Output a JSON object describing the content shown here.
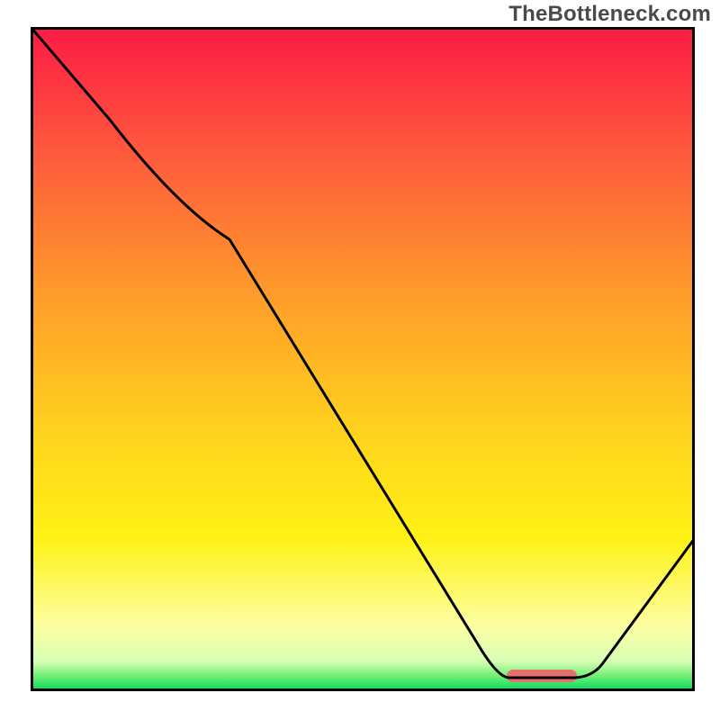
{
  "watermark": "TheBottleneck.com",
  "chart_data": {
    "type": "line",
    "title": "",
    "xlabel": "",
    "ylabel": "",
    "xlim": [
      0,
      1
    ],
    "ylim": [
      0,
      1
    ],
    "grid": false,
    "legend": false,
    "background": {
      "kind": "vertical-gradient",
      "description": "red at top through orange and yellow to pale-yellow, thin green band at bottom",
      "stops": [
        {
          "pos": 0.0,
          "color": "#fc1a45"
        },
        {
          "pos": 0.2,
          "color": "#fe5d3c"
        },
        {
          "pos": 0.4,
          "color": "#ff9b2b"
        },
        {
          "pos": 0.6,
          "color": "#ffd01e"
        },
        {
          "pos": 0.77,
          "color": "#fff215"
        },
        {
          "pos": 0.9,
          "color": "#fdffa0"
        },
        {
          "pos": 0.955,
          "color": "#d6ffb5"
        },
        {
          "pos": 0.975,
          "color": "#7af07a"
        },
        {
          "pos": 1.0,
          "color": "#00db5a"
        }
      ]
    },
    "sweet_spot_marker": {
      "x_range": [
        0.72,
        0.82
      ],
      "y": 0.02,
      "color": "#e76f6f",
      "note": "short rounded bar marking the optimum near x≈0.77"
    },
    "series": [
      {
        "name": "curve",
        "color": "#000000",
        "x": [
          0.0,
          0.12,
          0.22,
          0.3,
          0.68,
          0.72,
          0.82,
          0.86,
          1.0
        ],
        "y": [
          1.0,
          0.86,
          0.73,
          0.68,
          0.06,
          0.02,
          0.02,
          0.04,
          0.23
        ],
        "shape_notes": "Starts at top-left, gentle bend around x≈0.22–0.30, long straight descent to x≈0.68, flat minimum 0.72–0.82, then rises roughly linearly to the right edge."
      }
    ]
  }
}
